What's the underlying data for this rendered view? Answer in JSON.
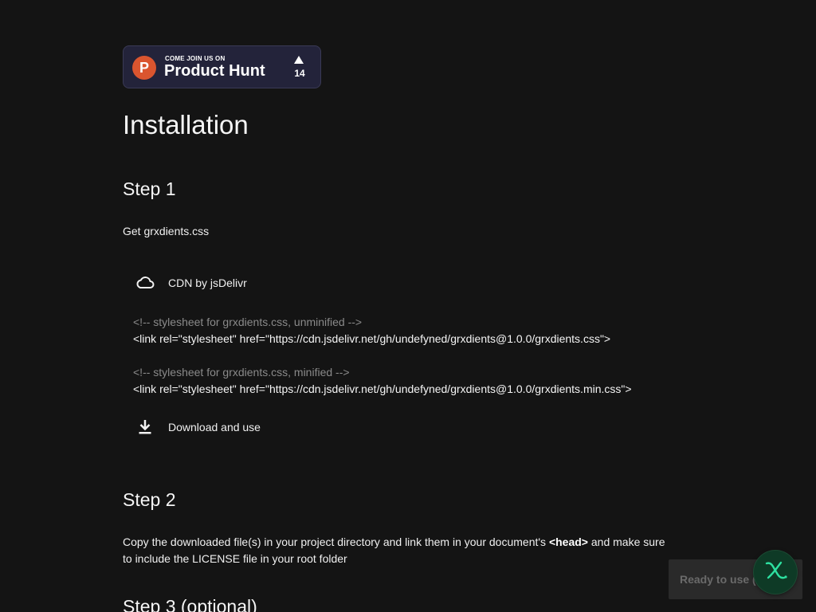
{
  "badge": {
    "small_text": "COME JOIN US ON",
    "big_text": "Product Hunt",
    "logo_letter": "P",
    "upvotes": "14",
    "brand_color": "#da552f"
  },
  "page": {
    "title": "Installation"
  },
  "step1": {
    "heading": "Step 1",
    "text": "Get grxdients.css",
    "cdn_option": {
      "icon": "cloud-icon",
      "label": "CDN by jsDelivr"
    },
    "code": [
      {
        "comment": "<!-- stylesheet for grxdients.css, unminified -->",
        "line": "<link rel=\"stylesheet\" href=\"https://cdn.jsdelivr.net/gh/undefyned/grxdients@1.0.0/grxdients.css\">"
      },
      {
        "comment": "<!-- stylesheet for grxdients.css, minified -->",
        "line": "<link rel=\"stylesheet\" href=\"https://cdn.jsdelivr.net/gh/undefyned/grxdients@1.0.0/grxdients.min.css\">"
      }
    ],
    "download_option": {
      "icon": "download-icon",
      "label": "Download and use"
    }
  },
  "step2": {
    "heading": "Step 2",
    "text_before": "Copy the downloaded file(s) in your project directory and link them in your document's ",
    "head_tag": "<head>",
    "text_after": " and make sure",
    "text_line2": "to include the LICENSE file in your root folder"
  },
  "step3": {
    "heading": "Step 3 (optional)"
  },
  "toast": {
    "text": "Ready to use ("
  },
  "fab": {
    "icon": "x-logo-icon",
    "accent": "#2de0a0"
  }
}
